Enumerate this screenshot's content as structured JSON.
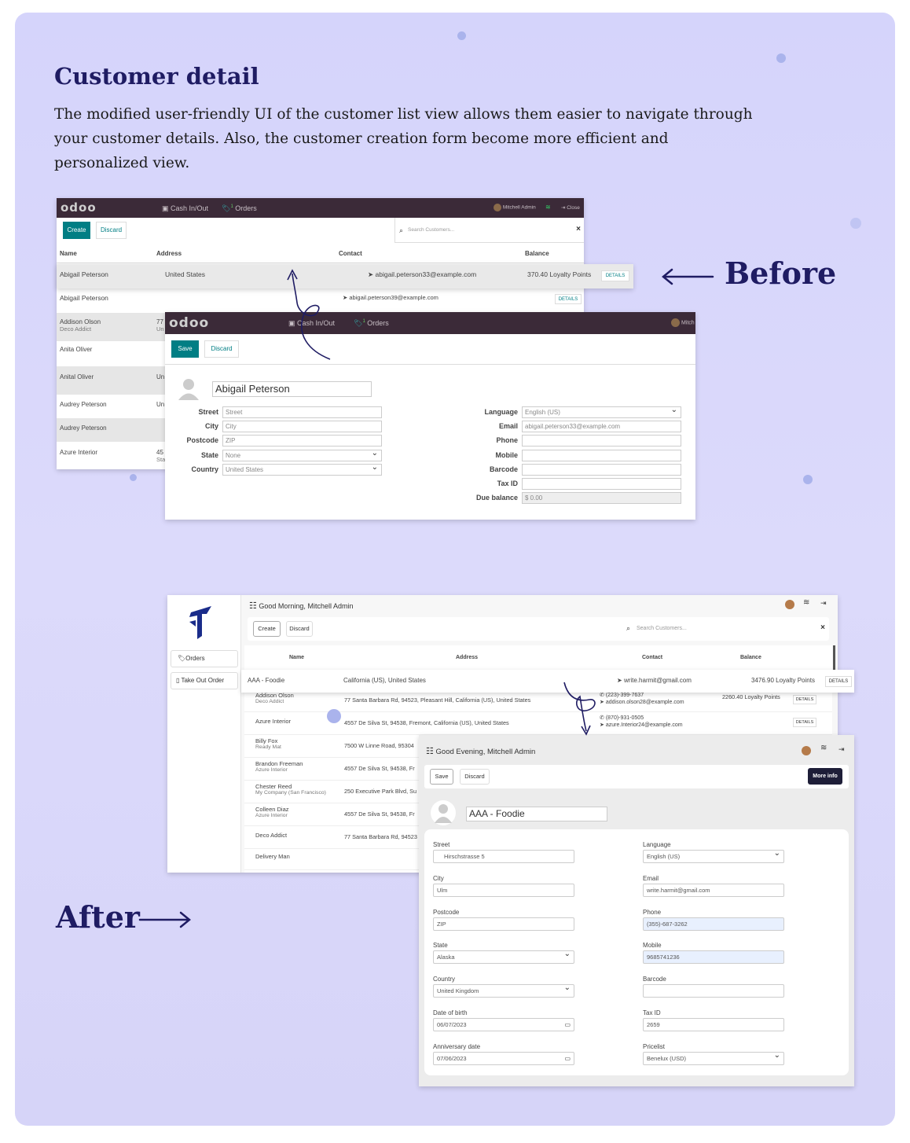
{
  "heading": "Customer detail",
  "description": "The modified user-friendly UI of the customer list view allows them easier to navigate through your customer details. Also, the customer creation form become more efficient and personalized view.",
  "before_label": "Before",
  "after_label": "After",
  "before_list": {
    "logo": "odoo",
    "cash_label": "Cash In/Out",
    "orders_label": "Orders",
    "orders_badge": "1",
    "user": "Mitchell Admin",
    "close_label": "Close",
    "create_label": "Create",
    "discard_label": "Discard",
    "search_placeholder": "Search Customers...",
    "clear_symbol": "×",
    "details_label": "DETAILS",
    "columns": [
      "Name",
      "Address",
      "Contact",
      "Balance"
    ],
    "highlight_row": {
      "name": "Abigail Peterson",
      "address": "United States",
      "contact": "abigail.peterson33@example.com",
      "balance": "370.40 Loyalty Points"
    },
    "rows": [
      {
        "name": "Abigail Peterson",
        "sub": "",
        "address": "",
        "address2": "",
        "contact": "abigail.peterson39@example.com"
      },
      {
        "name": "Addison Olson",
        "sub": "Deco Addict",
        "address": "77",
        "address2": "Un",
        "contact": ""
      },
      {
        "name": "Anita Oliver",
        "sub": "",
        "address": "",
        "address2": "",
        "contact": ""
      },
      {
        "name": "Anital Oliver",
        "sub": "",
        "address": "Un",
        "address2": "",
        "contact": ""
      },
      {
        "name": "Audrey Peterson",
        "sub": "",
        "address": "Un",
        "address2": "",
        "contact": ""
      },
      {
        "name": "Audrey Peterson",
        "sub": "",
        "address": "",
        "address2": "",
        "contact": ""
      },
      {
        "name": "Azure Interior",
        "sub": "",
        "address": "45",
        "address2": "Sta",
        "contact": ""
      }
    ]
  },
  "before_form": {
    "logo": "odoo",
    "cash_label": "Cash In/Out",
    "orders_label": "Orders",
    "orders_badge": "1",
    "user_partial": "Mitch",
    "save_label": "Save",
    "discard_label": "Discard",
    "name": "Abigail Peterson",
    "left_fields": [
      {
        "label": "Street",
        "value": "Street",
        "select": false
      },
      {
        "label": "City",
        "value": "City",
        "select": false
      },
      {
        "label": "Postcode",
        "value": "ZIP",
        "select": false
      },
      {
        "label": "State",
        "value": "None",
        "select": true
      },
      {
        "label": "Country",
        "value": "United States",
        "select": true
      }
    ],
    "right_fields": [
      {
        "label": "Language",
        "value": "English (US)",
        "select": true
      },
      {
        "label": "Email",
        "value": "abigail.peterson33@example.com",
        "select": false
      },
      {
        "label": "Phone",
        "value": "",
        "select": false
      },
      {
        "label": "Mobile",
        "value": "",
        "select": false
      },
      {
        "label": "Barcode",
        "value": "",
        "select": false
      },
      {
        "label": "Tax ID",
        "value": "",
        "select": false
      },
      {
        "label": "Due balance",
        "value": "$ 0.00",
        "select": false
      }
    ]
  },
  "after_list": {
    "greeting_prefix": "Good Morning,",
    "user": "Mitchell Admin",
    "create_label": "Create",
    "discard_label": "Discard",
    "search_placeholder": "Search Customers...",
    "clear_symbol": "×",
    "sidebar_orders": "Orders",
    "sidebar_takeout": "Take Out Order",
    "columns": [
      "Name",
      "Address",
      "Contact",
      "Balance"
    ],
    "details_label": "DETAILS",
    "highlight_row": {
      "name": "AAA - Foodie",
      "address": "California (US), United States",
      "contact": "write.harmit@gmail.com",
      "balance": "3476.90 Loyalty Points"
    },
    "rows": [
      {
        "name": "Addison Olson",
        "sub": "Deco Addict",
        "address": "77 Santa Barbara Rd, 94523, Pleasant Hill, California (US), United States",
        "phone": "(223)-399-7637",
        "email": "addison.olson28@example.com",
        "balance": "2260.40 Loyalty Points",
        "details": true
      },
      {
        "name": "Azure Interior",
        "sub": "",
        "address": "4557 De Silva St, 94538, Fremont, California (US), United States",
        "phone": "(870)-931-0505",
        "email": "azure.Interior24@example.com",
        "balance": "",
        "details": true
      },
      {
        "name": "Billy Fox",
        "sub": "Ready Mat",
        "address": "7500 W Linne Road, 95304",
        "phone": "",
        "email": "",
        "balance": "",
        "details": false
      },
      {
        "name": "Brandon Freeman",
        "sub": "Azure Interior",
        "address": "4557 De Silva St, 94538, Fr",
        "phone": "",
        "email": "",
        "balance": "",
        "details": false
      },
      {
        "name": "Chester Reed",
        "sub": "My Company (San Francisco)",
        "address": "250 Executive Park Blvd, Su",
        "phone": "",
        "email": "",
        "balance": "",
        "details": false
      },
      {
        "name": "Colleen Diaz",
        "sub": "Azure Interior",
        "address": "4557 De Silva St, 94538, Fr",
        "phone": "",
        "email": "",
        "balance": "",
        "details": false
      },
      {
        "name": "Deco Addict",
        "sub": "",
        "address": "77 Santa Barbara Rd, 94523",
        "phone": "",
        "email": "",
        "balance": "",
        "details": false
      },
      {
        "name": "Delivery Man",
        "sub": "",
        "address": "",
        "phone": "",
        "email": "",
        "balance": "",
        "details": false
      }
    ]
  },
  "after_form": {
    "greeting_prefix": "Good Evening,",
    "user": "Mitchell Admin",
    "save_label": "Save",
    "discard_label": "Discard",
    "more_info_label": "More info",
    "name": "AAA - Foodie",
    "left_fields": [
      {
        "label": "Street",
        "value": "Hirschstrasse 5",
        "kind": "text"
      },
      {
        "label": "City",
        "value": "Ulm",
        "kind": "text"
      },
      {
        "label": "Postcode",
        "value": "ZIP",
        "kind": "text"
      },
      {
        "label": "State",
        "value": "Alaska",
        "kind": "select"
      },
      {
        "label": "Country",
        "value": "United Kingdom",
        "kind": "select"
      },
      {
        "label": "Date of birth",
        "value": "06/07/2023",
        "kind": "date"
      },
      {
        "label": "Anniversary date",
        "value": "07/06/2023",
        "kind": "date"
      }
    ],
    "right_fields": [
      {
        "label": "Language",
        "value": "English (US)",
        "kind": "select"
      },
      {
        "label": "Email",
        "value": "write.harmit@gmail.com",
        "kind": "text"
      },
      {
        "label": "Phone",
        "value": "(355)-687-3262",
        "kind": "blue"
      },
      {
        "label": "Mobile",
        "value": "9685741236",
        "kind": "blue"
      },
      {
        "label": "Barcode",
        "value": "",
        "kind": "text"
      },
      {
        "label": "Tax ID",
        "value": "2659",
        "kind": "text"
      },
      {
        "label": "Pricelist",
        "value": "Benelux (USD)",
        "kind": "select"
      }
    ]
  },
  "colors": {
    "brand_dark": "#1f1c63",
    "odoo_bar": "#3b2a38",
    "odoo_teal": "#017e84",
    "arrow": "#1f1c63"
  }
}
